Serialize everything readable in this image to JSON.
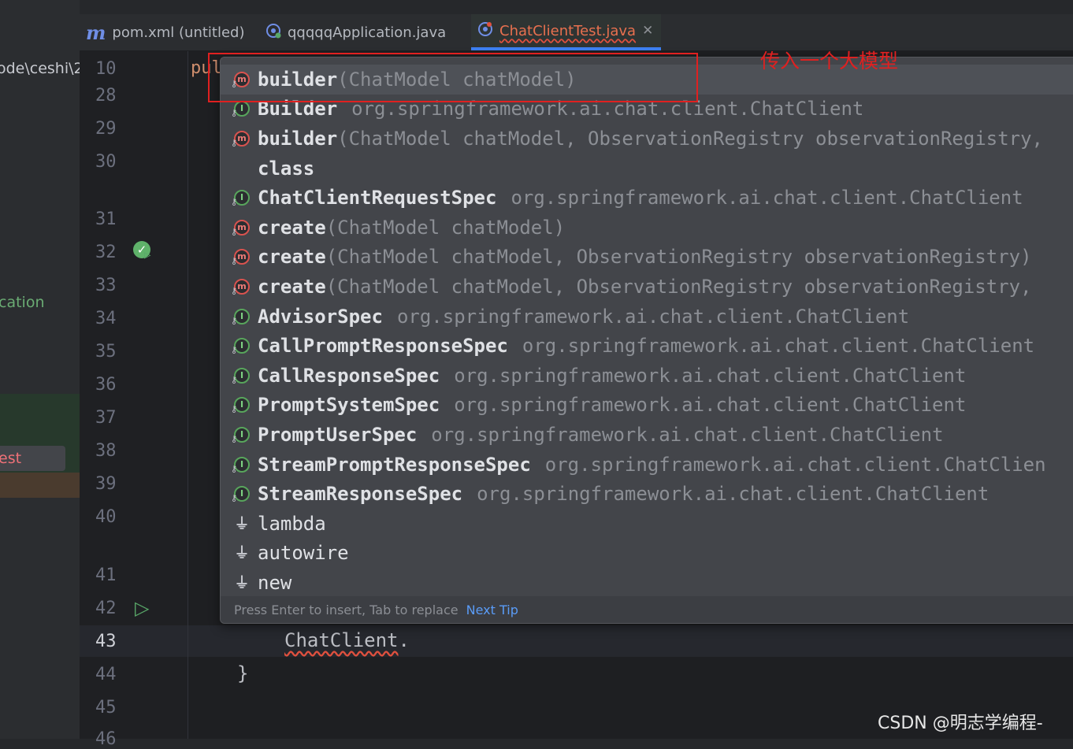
{
  "project_panel": {
    "path_fragment": "ode\\ceshi\\2",
    "app_fragment": "cation",
    "test_fragment": "est"
  },
  "tabs": [
    {
      "icon": "m",
      "label": "pom.xml (untitled)"
    },
    {
      "icon": "G",
      "label": "qqqqqApplication.java"
    },
    {
      "icon": "C",
      "label": "ChatClientTest.java",
      "close": "✕"
    }
  ],
  "gutter": {
    "line_numbers": [
      "10",
      "28",
      "29",
      "30",
      "31",
      "32",
      "33",
      "34",
      "35",
      "36",
      "37",
      "38",
      "39",
      "40",
      "41",
      "42",
      "43",
      "44",
      "45",
      "46"
    ],
    "current_line": "43"
  },
  "code": {
    "keyword_fragment": "pul",
    "current_line_class": "ChatClient",
    "current_line_suffix": ".",
    "closing_brace": "}"
  },
  "completion": {
    "items": [
      {
        "kind": "method",
        "name": "builder",
        "signature": "(ChatModel chatModel)",
        "package": "",
        "selected": true
      },
      {
        "kind": "interface",
        "name": "Builder",
        "signature": "",
        "package": "org.springframework.ai.chat.client.ChatClient"
      },
      {
        "kind": "method",
        "name": "builder",
        "signature": "(ChatModel chatModel, ObservationRegistry observationRegistry,",
        "package": ""
      },
      {
        "kind": "keyword",
        "name": "class",
        "signature": "",
        "package": ""
      },
      {
        "kind": "interface",
        "name": "ChatClientRequestSpec",
        "signature": "",
        "package": "org.springframework.ai.chat.client.ChatClient"
      },
      {
        "kind": "method",
        "name": "create",
        "signature": "(ChatModel chatModel)",
        "package": ""
      },
      {
        "kind": "method",
        "name": "create",
        "signature": "(ChatModel chatModel, ObservationRegistry observationRegistry)",
        "package": ""
      },
      {
        "kind": "method",
        "name": "create",
        "signature": "(ChatModel chatModel, ObservationRegistry observationRegistry,",
        "package": ""
      },
      {
        "kind": "interface",
        "name": "AdvisorSpec",
        "signature": "",
        "package": "org.springframework.ai.chat.client.ChatClient"
      },
      {
        "kind": "interface",
        "name": "CallPromptResponseSpec",
        "signature": "",
        "package": "org.springframework.ai.chat.client.ChatClient"
      },
      {
        "kind": "interface",
        "name": "CallResponseSpec",
        "signature": "",
        "package": "org.springframework.ai.chat.client.ChatClient"
      },
      {
        "kind": "interface",
        "name": "PromptSystemSpec",
        "signature": "",
        "package": "org.springframework.ai.chat.client.ChatClient"
      },
      {
        "kind": "interface",
        "name": "PromptUserSpec",
        "signature": "",
        "package": "org.springframework.ai.chat.client.ChatClient"
      },
      {
        "kind": "interface",
        "name": "StreamPromptResponseSpec",
        "signature": "",
        "package": "org.springframework.ai.chat.client.ChatClien"
      },
      {
        "kind": "interface",
        "name": "StreamResponseSpec",
        "signature": "",
        "package": "org.springframework.ai.chat.client.ChatClient"
      },
      {
        "kind": "template",
        "name": "lambda",
        "signature": "",
        "package": ""
      },
      {
        "kind": "template",
        "name": "autowire",
        "signature": "",
        "package": ""
      },
      {
        "kind": "template",
        "name": "new",
        "signature": "",
        "package": ""
      }
    ],
    "footer_hint": "Press Enter to insert, Tab to replace",
    "footer_link": "Next Tip"
  },
  "annotation": {
    "text": "传入一个大模型",
    "color": "#e02020"
  },
  "watermark": "CSDN @明志学编程-",
  "colors": {
    "editor_bg": "#1e1f22",
    "popup_bg": "#43454a",
    "accent": "#3d7ff0",
    "error": "#e0503e"
  }
}
